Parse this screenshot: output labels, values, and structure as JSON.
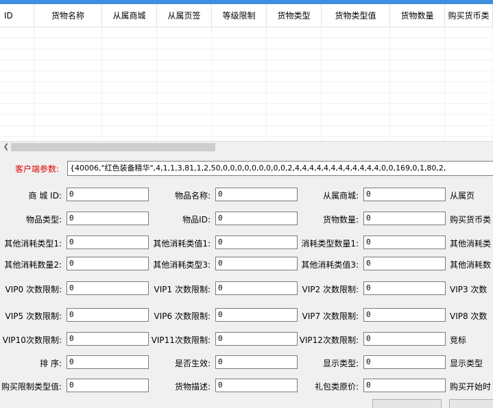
{
  "columns": [
    "ID",
    "货物名称",
    "从属商城",
    "从属页签",
    "等级限制",
    "货物类型",
    "货物类型值",
    "货物数量",
    "购买货币类"
  ],
  "client_params": {
    "label": "客户端参数:",
    "value": "{40006,\"红色装备精华\",4,1,1,3,81,1,2,50,0,0,0,0,0,0,0,0,0,2,4,4,4,4,4,4,4,4,4,4,4,4,0,0,169,0,1,80,2,"
  },
  "rows": [
    [
      {
        "label": "商  城  ID:",
        "value": "0"
      },
      {
        "label": "物品名称:",
        "value": "0"
      },
      {
        "label": "从属商城:",
        "value": "0"
      },
      {
        "label": "从属页",
        "value": ""
      }
    ],
    [
      {
        "label": "物品类型:",
        "value": "0"
      },
      {
        "label": "物品ID:",
        "value": "0"
      },
      {
        "label": "货物数量:",
        "value": "0"
      },
      {
        "label": "购买货币类",
        "value": ""
      }
    ],
    [
      {
        "label": "其他消耗类型1:",
        "value": "0"
      },
      {
        "label": "其他消耗类值1:",
        "value": "0"
      },
      {
        "label": "消耗类型数量1:",
        "value": "0"
      },
      {
        "label": "其他消耗类",
        "value": ""
      }
    ],
    [
      {
        "label": "其他消耗数量2:",
        "value": "0"
      },
      {
        "label": "其他消耗类型3:",
        "value": "0"
      },
      {
        "label": "其他消耗类值3:",
        "value": "0"
      },
      {
        "label": "其他消耗数",
        "value": ""
      }
    ],
    [
      {
        "label": "VIP0 次数限制:",
        "value": "0"
      },
      {
        "label": "VIP1 次数限制:",
        "value": "0"
      },
      {
        "label": "VIP2 次数限制:",
        "value": "0"
      },
      {
        "label": "VIP3 次数",
        "value": ""
      }
    ],
    [
      {
        "label": "VIP5 次数限制:",
        "value": "0"
      },
      {
        "label": "VIP6 次数限制:",
        "value": "0"
      },
      {
        "label": "VIP7 次数限制:",
        "value": "0"
      },
      {
        "label": "VIP8 次数",
        "value": ""
      }
    ],
    [
      {
        "label": "VIP10次数限制:",
        "value": "0"
      },
      {
        "label": "VIP11次数限制:",
        "value": "0"
      },
      {
        "label": "VIP12次数限制:",
        "value": "0"
      },
      {
        "label": "竞标",
        "value": ""
      }
    ],
    [
      {
        "label": "排     序:",
        "value": "0"
      },
      {
        "label": "是否生效:",
        "value": "0"
      },
      {
        "label": "显示类型:",
        "value": "0"
      },
      {
        "label": "显示类型",
        "value": ""
      }
    ],
    [
      {
        "label": "购买限制类型值:",
        "value": "0"
      },
      {
        "label": "货物描述:",
        "value": "0"
      },
      {
        "label": "礼包类原价:",
        "value": "0"
      },
      {
        "label": "购买开始时",
        "value": ""
      }
    ]
  ]
}
